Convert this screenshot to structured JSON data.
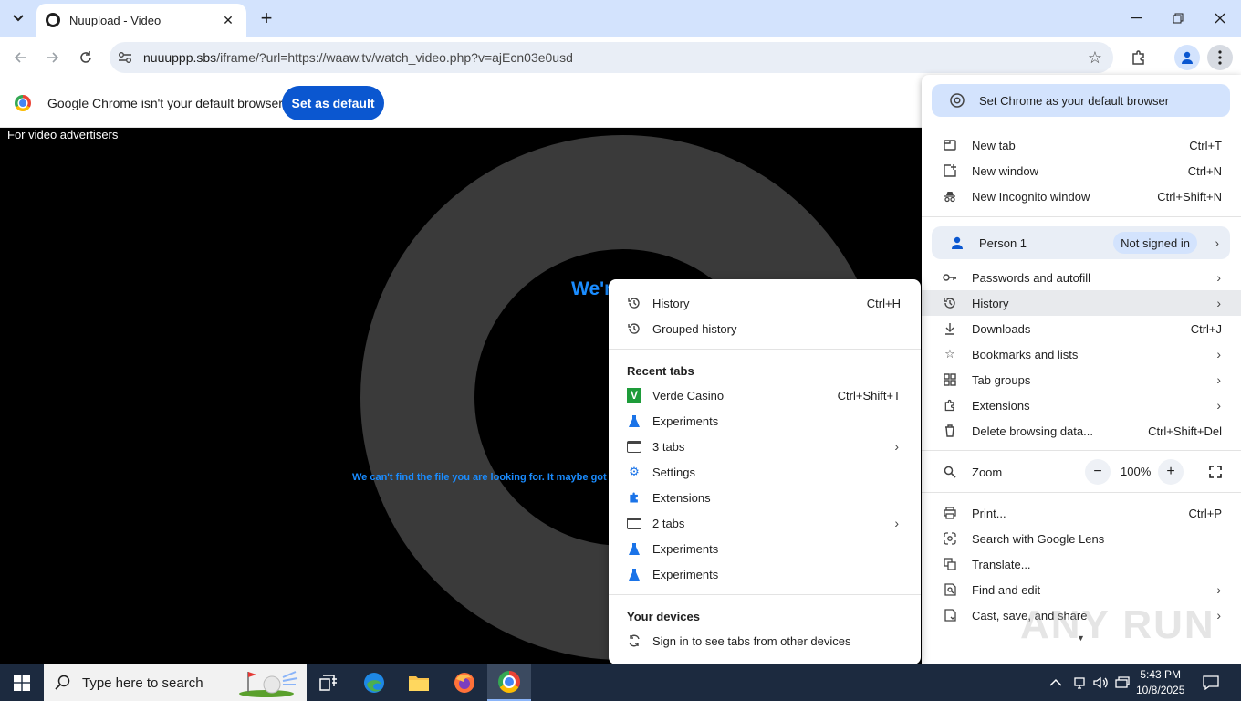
{
  "browser": {
    "tab": {
      "title": "Nuupload - Video"
    },
    "omnibox": {
      "host": "nuuuppp.sbs",
      "path": "/iframe/?url=https://waaw.tv/watch_video.php?v=ajEcn03e0usd"
    }
  },
  "infobar": {
    "message": "Google Chrome isn't your default browser",
    "button": "Set as default"
  },
  "page": {
    "advertisers": "For video advertisers",
    "error_title": "We'r",
    "error_message": "We can't find the file you are looking for. It maybe got de"
  },
  "menu": {
    "default_banner": "Set Chrome as your default browser",
    "items": [
      {
        "label": "New tab",
        "shortcut": "Ctrl+T"
      },
      {
        "label": "New window",
        "shortcut": "Ctrl+N"
      },
      {
        "label": "New Incognito window",
        "shortcut": "Ctrl+Shift+N"
      }
    ],
    "profile": {
      "name": "Person 1",
      "status": "Not signed in"
    },
    "items2": [
      {
        "label": "Passwords and autofill"
      },
      {
        "label": "History"
      },
      {
        "label": "Downloads",
        "shortcut": "Ctrl+J"
      },
      {
        "label": "Bookmarks and lists"
      },
      {
        "label": "Tab groups"
      },
      {
        "label": "Extensions"
      },
      {
        "label": "Delete browsing data...",
        "shortcut": "Ctrl+Shift+Del"
      }
    ],
    "zoom": {
      "label": "Zoom",
      "value": "100%"
    },
    "items3": [
      {
        "label": "Print...",
        "shortcut": "Ctrl+P"
      },
      {
        "label": "Search with Google Lens"
      },
      {
        "label": "Translate..."
      },
      {
        "label": "Find and edit"
      },
      {
        "label": "Cast, save, and share"
      }
    ]
  },
  "history_submenu": {
    "items": [
      {
        "label": "History",
        "shortcut": "Ctrl+H"
      },
      {
        "label": "Grouped history"
      }
    ],
    "recent_heading": "Recent tabs",
    "recent": [
      {
        "label": "Verde Casino",
        "shortcut": "Ctrl+Shift+T",
        "icon": "verde-casino-icon"
      },
      {
        "label": "Experiments",
        "icon": "flask-icon"
      },
      {
        "label": "3 tabs",
        "icon": "window-icon"
      },
      {
        "label": "Settings",
        "icon": "gear-icon"
      },
      {
        "label": "Extensions",
        "icon": "puzzle-icon"
      },
      {
        "label": "2 tabs",
        "icon": "window-icon"
      },
      {
        "label": "Experiments",
        "icon": "flask-icon"
      },
      {
        "label": "Experiments",
        "icon": "flask-icon"
      }
    ],
    "devices_heading": "Your devices",
    "devices_item": "Sign in to see tabs from other devices"
  },
  "watermark": "ANY RUN",
  "taskbar": {
    "search_placeholder": "Type here to search",
    "time": "5:43 PM",
    "date": "10/8/2025"
  },
  "colors": {
    "accent": "#0b57d0",
    "tabstrip": "#d3e3fd",
    "error_text": "#1a8cff",
    "taskbar": "#1c2a3f"
  }
}
